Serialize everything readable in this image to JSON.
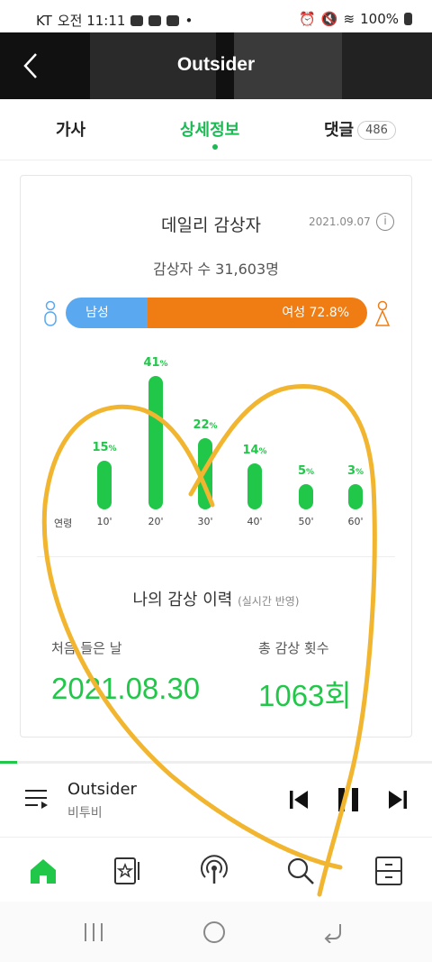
{
  "status_bar": {
    "carrier": "KT",
    "time": "오전 11:11",
    "battery": "100%"
  },
  "header": {
    "title": "Outsider"
  },
  "tabs": [
    {
      "label": "가사"
    },
    {
      "label": "상세정보"
    },
    {
      "label": "댓글",
      "badge": "486"
    }
  ],
  "daily_listeners": {
    "title": "데일리 감상자",
    "date": "2021.09.07",
    "count_text": "감상자 수 31,603명",
    "male": {
      "label": "남성 27.2%",
      "percent": 27.2
    },
    "female": {
      "label": "여성 72.8%",
      "percent": 72.8
    },
    "age_axis_label": "연령"
  },
  "chart_data": {
    "type": "bar",
    "categories": [
      "10'",
      "20'",
      "30'",
      "40'",
      "50'",
      "60'"
    ],
    "values": [
      15,
      41,
      22,
      14,
      5,
      3
    ],
    "unit": "%"
  },
  "history": {
    "title": "나의 감상 이력",
    "subtitle": "(실시간 반영)",
    "first_listen_label": "처음 들은 날",
    "first_listen_value": "2021.08.30",
    "total_count_label": "총 감상 횟수",
    "total_count_value": "1063회"
  },
  "player": {
    "title": "Outsider",
    "artist": "비투비",
    "progress": 0.04
  },
  "colors": {
    "accent": "#20c748",
    "male": "#5aa9f0",
    "female": "#f07d14",
    "scribble": "#f2b530"
  },
  "icons": {
    "nav": [
      "home-icon",
      "music-library-icon",
      "podcast-icon",
      "search-icon",
      "storage-icon"
    ],
    "player": [
      "playlist-icon",
      "previous-icon",
      "pause-icon",
      "next-icon"
    ]
  }
}
